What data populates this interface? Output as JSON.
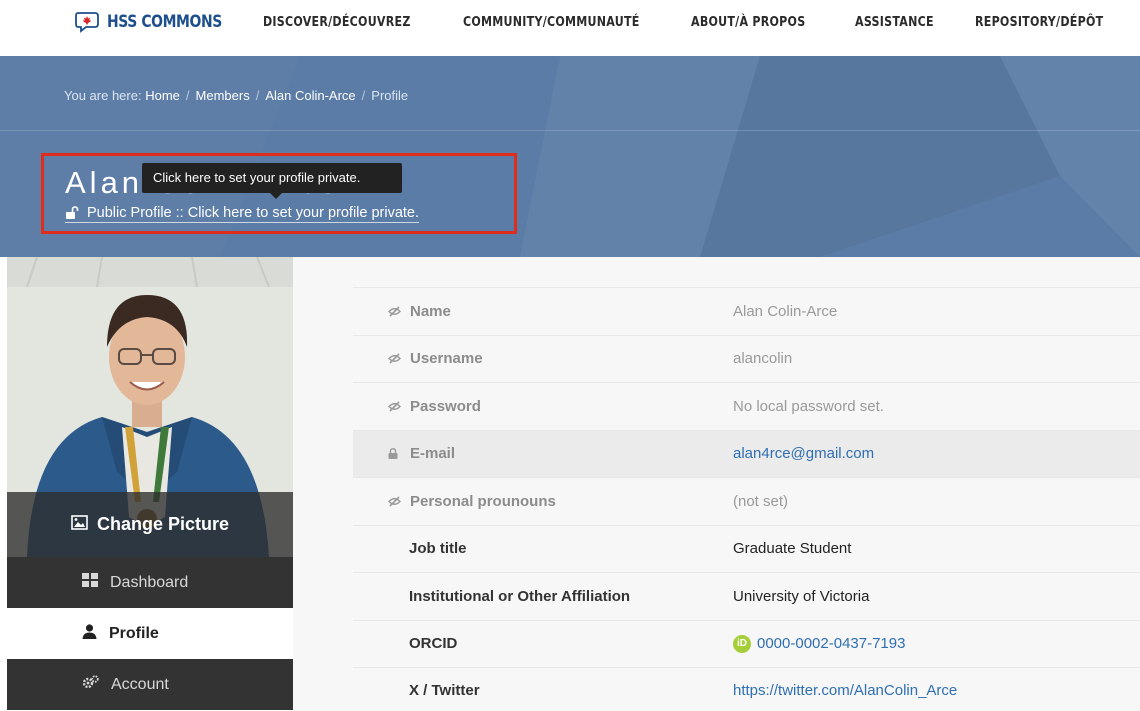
{
  "nav": {
    "logo_text": "HSS COMMONS",
    "items": [
      {
        "label": "DISCOVER/DÉCOUVREZ"
      },
      {
        "label": "COMMUNITY/COMMUNAUTÉ"
      },
      {
        "label": "ABOUT/À PROPOS"
      },
      {
        "label": "ASSISTANCE"
      },
      {
        "label": "REPOSITORY/DÉPÔT"
      }
    ]
  },
  "breadcrumb": {
    "prefix": "You are here:",
    "items": [
      "Home",
      "Members",
      "Alan Colin-Arce",
      "Profile"
    ]
  },
  "header": {
    "name": "Alan Colin-Arce",
    "privacy_link": "Public Profile :: Click here to set your profile private.",
    "tooltip": "Click here to set your profile private."
  },
  "sidebar": {
    "change_picture": "Change Picture",
    "items": [
      {
        "label": "Dashboard",
        "icon": "dashboard-icon"
      },
      {
        "label": "Profile",
        "icon": "user-icon"
      },
      {
        "label": "Account",
        "icon": "gears-icon"
      }
    ]
  },
  "profile": {
    "rows": [
      {
        "label": "Name",
        "value": "Alan Colin-Arce",
        "icon": "eye-slash-icon"
      },
      {
        "label": "Username",
        "value": "alancolin",
        "icon": "eye-slash-icon"
      },
      {
        "label": "Password",
        "value": "No local password set.",
        "icon": "eye-slash-icon"
      },
      {
        "label": "E-mail",
        "value": "alan4rce@gmail.com",
        "icon": "lock-icon"
      },
      {
        "label": "Personal prounouns",
        "value": "(not set)",
        "icon": "eye-slash-icon"
      },
      {
        "label": "Job title",
        "value": "Graduate Student"
      },
      {
        "label": "Institutional or Other Affiliation",
        "value": "University of Victoria"
      },
      {
        "label": "ORCID",
        "value": "0000-0002-0437-7193",
        "badge": "iD"
      },
      {
        "label": "X / Twitter",
        "value": "https://twitter.com/AlanColin_Arce"
      }
    ]
  },
  "colors": {
    "band": "#5b7ca6",
    "highlight": "#e02d1b",
    "link": "#2f6fb3",
    "sidebar_dark": "#333333",
    "orcid": "#a6ce39"
  }
}
